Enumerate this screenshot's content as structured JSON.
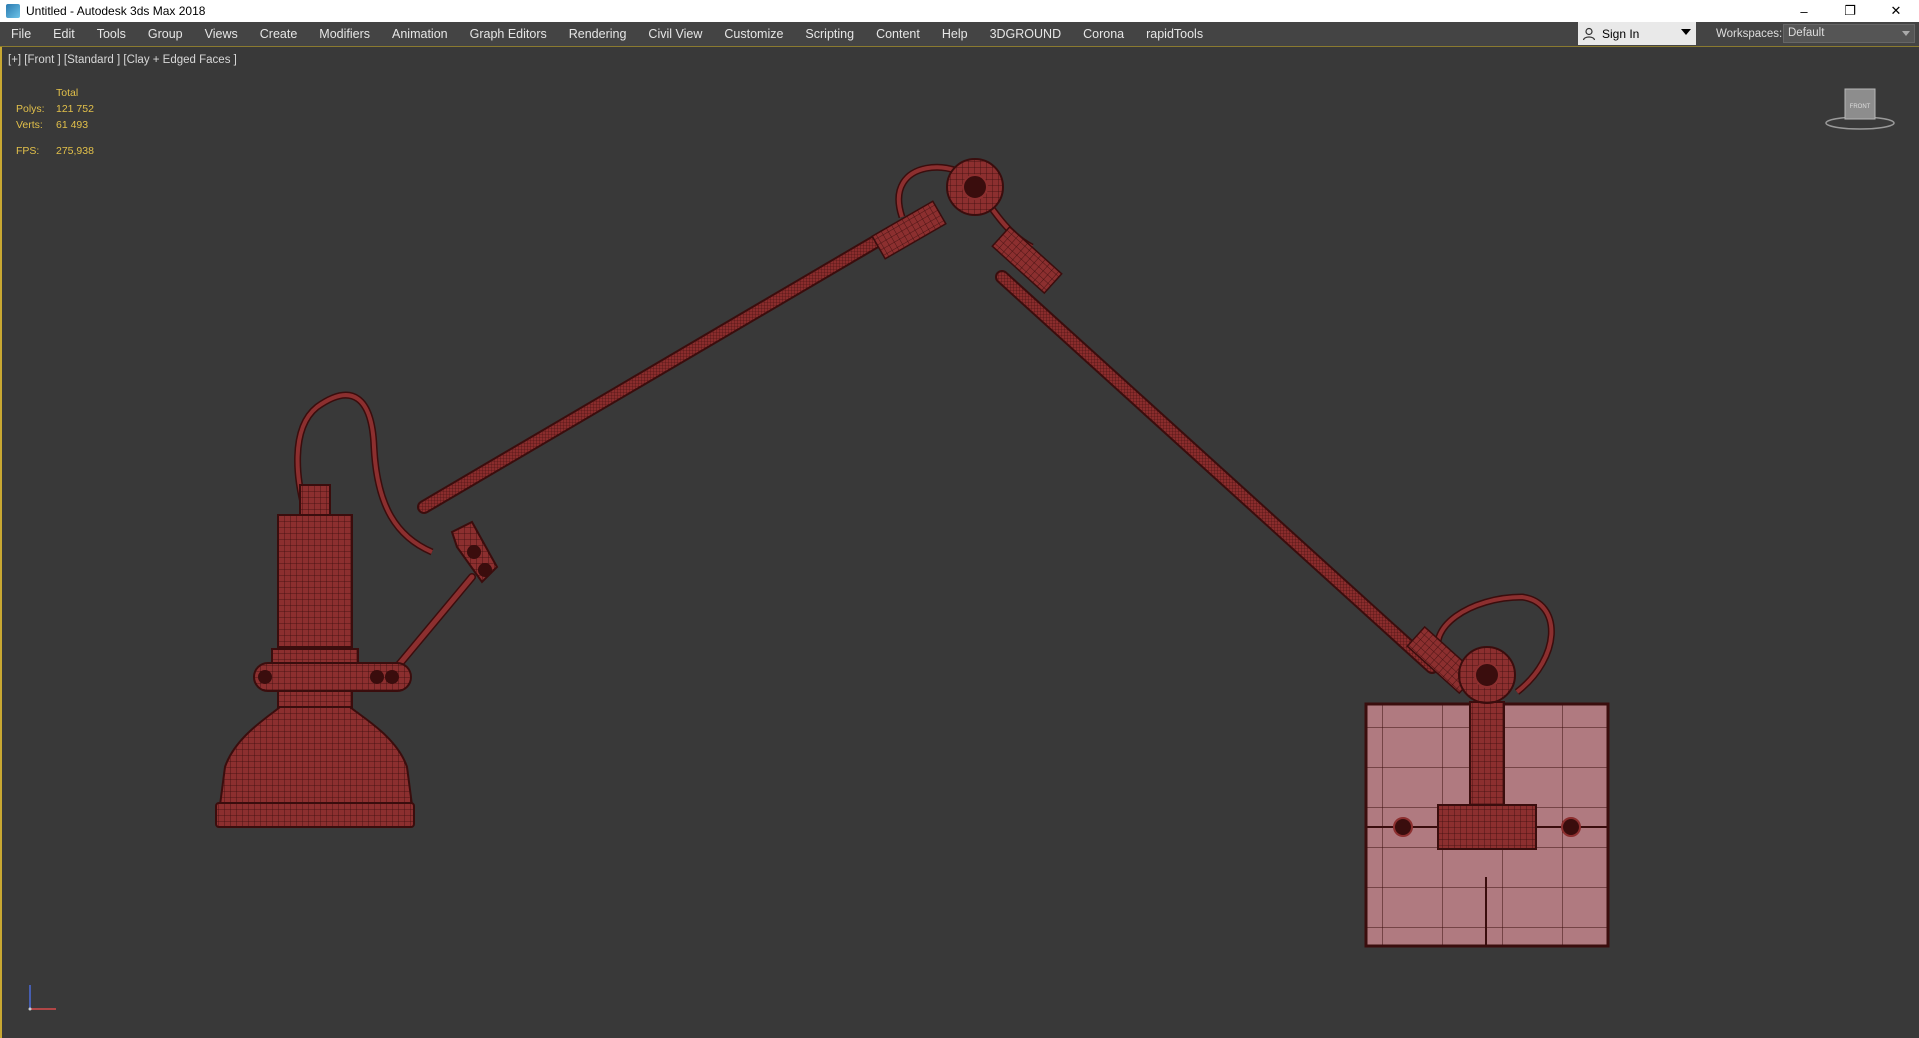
{
  "window": {
    "title": "Untitled - Autodesk 3ds Max 2018",
    "minimize": "–",
    "restore": "❐",
    "close": "✕"
  },
  "menu": {
    "items": [
      "File",
      "Edit",
      "Tools",
      "Group",
      "Views",
      "Create",
      "Modifiers",
      "Animation",
      "Graph Editors",
      "Rendering",
      "Civil View",
      "Customize",
      "Scripting",
      "Content",
      "Help",
      "3DGROUND",
      "Corona",
      "rapidTools"
    ]
  },
  "account": {
    "signin_label": "Sign In",
    "icon": "user-icon"
  },
  "workspaces": {
    "label": "Workspaces:",
    "selected": "Default"
  },
  "viewport": {
    "label": "[+] [Front ] [Standard ] [Clay + Edged Faces ]",
    "stats": {
      "header": "Total",
      "polys_label": "Polys:",
      "polys_value": "121 752",
      "verts_label": "Verts:",
      "verts_value": "61 493",
      "fps_label": "FPS:",
      "fps_value": "275,938"
    },
    "viewcube_label": "FRONT",
    "wire_color": "#8c2f2f",
    "edge_color": "#3a0d0d",
    "stats_color": "#e2c04a",
    "frame_color": "#c8a832"
  }
}
